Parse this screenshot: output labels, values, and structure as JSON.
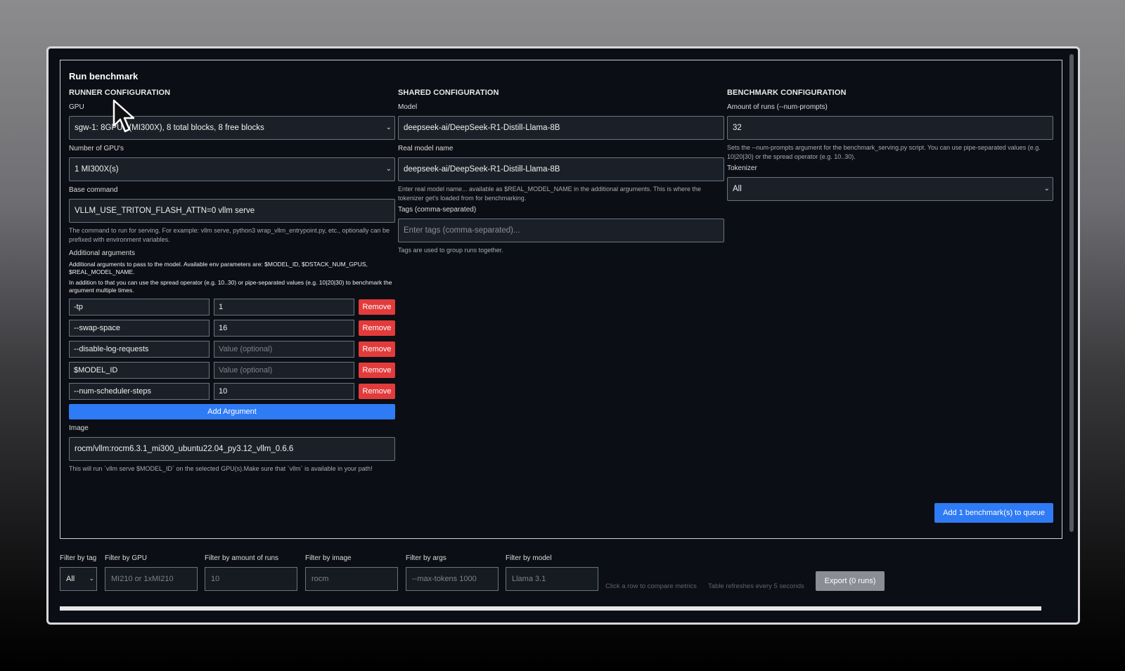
{
  "panel": {
    "title": "Run benchmark",
    "runner": {
      "heading": "RUNNER CONFIGURATION",
      "gpu_label": "GPU",
      "gpu_value": "sgw-1: 8GPUs (MI300X), 8 total blocks, 8 free blocks",
      "num_gpus_label": "Number of GPU's",
      "num_gpus_value": "1 MI300X(s)",
      "base_cmd_label": "Base command",
      "base_cmd_value": "VLLM_USE_TRITON_FLASH_ATTN=0 vllm serve",
      "base_cmd_help": "The command to run for serving. For example: vllm serve, python3 wrap_vllm_entrypoint.py, etc., optionally can be prefixed with environment variables.",
      "args_label": "Additional arguments",
      "args_help_1": "Additional arguments to pass to the model. Available env parameters are: $MODEL_ID, $DSTACK_NUM_GPUS, $REAL_MODEL_NAME.",
      "args_help_2": "In addition to that you can use the spread operator (e.g. 10..30) or pipe-separated values (e.g. 10|20|30) to benchmark the argument multiple times.",
      "arguments": [
        {
          "name": "-tp",
          "value": "1"
        },
        {
          "name": "--swap-space",
          "value": "16"
        },
        {
          "name": "--disable-log-requests",
          "value": ""
        },
        {
          "name": "$MODEL_ID",
          "value": ""
        },
        {
          "name": "--num-scheduler-steps",
          "value": "10"
        }
      ],
      "value_placeholder": "Value (optional)",
      "remove_label": "Remove",
      "add_argument_label": "Add Argument",
      "image_label": "Image",
      "image_value": "rocm/vllm:rocm6.3.1_mi300_ubuntu22.04_py3.12_vllm_0.6.6",
      "image_help": "This will run `vllm serve $MODEL_ID` on the selected GPU(s).Make sure that `vllm` is available in your path!"
    },
    "shared": {
      "heading": "SHARED CONFIGURATION",
      "model_label": "Model",
      "model_value": "deepseek-ai/DeepSeek-R1-Distill-Llama-8B",
      "real_model_label": "Real model name",
      "real_model_value": "deepseek-ai/DeepSeek-R1-Distill-Llama-8B",
      "real_model_help": "Enter real model name... available as $REAL_MODEL_NAME in the additional arguments. This is where the tokenizer get's loaded from for benchmarking.",
      "tags_label": "Tags (comma-separated)",
      "tags_placeholder": "Enter tags (comma-separated)...",
      "tags_help": "Tags are used to group runs together."
    },
    "benchmark": {
      "heading": "BENCHMARK CONFIGURATION",
      "runs_label": "Amount of runs (--num-prompts)",
      "runs_value": "32",
      "runs_help": "Sets the --num-prompts argument for the benchmark_serving.py script. You can use pipe-separated values (e.g. 10|20|30) or the spread operator (e.g. 10..30).",
      "tokenizer_label": "Tokenizer",
      "tokenizer_value": "All"
    },
    "queue_button": "Add 1 benchmark(s) to queue"
  },
  "filters": {
    "tag": {
      "label": "Filter by tag",
      "value": "All"
    },
    "gpu": {
      "label": "Filter by GPU",
      "placeholder": "MI210 or 1xMI210"
    },
    "runs": {
      "label": "Filter by amount of runs",
      "placeholder": "10"
    },
    "image": {
      "label": "Filter by image",
      "placeholder": "rocm"
    },
    "args": {
      "label": "Filter by args",
      "placeholder": "--max-tokens 1000"
    },
    "model": {
      "label": "Filter by model",
      "placeholder": "Llama 3.1"
    },
    "note_compare": "Click a row to compare metrics",
    "note_refresh": "Table refreshes every 5 seconds",
    "export_label": "Export (0 runs)"
  },
  "icons": {
    "select_chevron": "chevron-down-icon",
    "cursor": "mouse-pointer-icon"
  },
  "colors": {
    "accent": "#2f7bf5",
    "danger": "#e23b3b",
    "background": "#0b0e14"
  }
}
